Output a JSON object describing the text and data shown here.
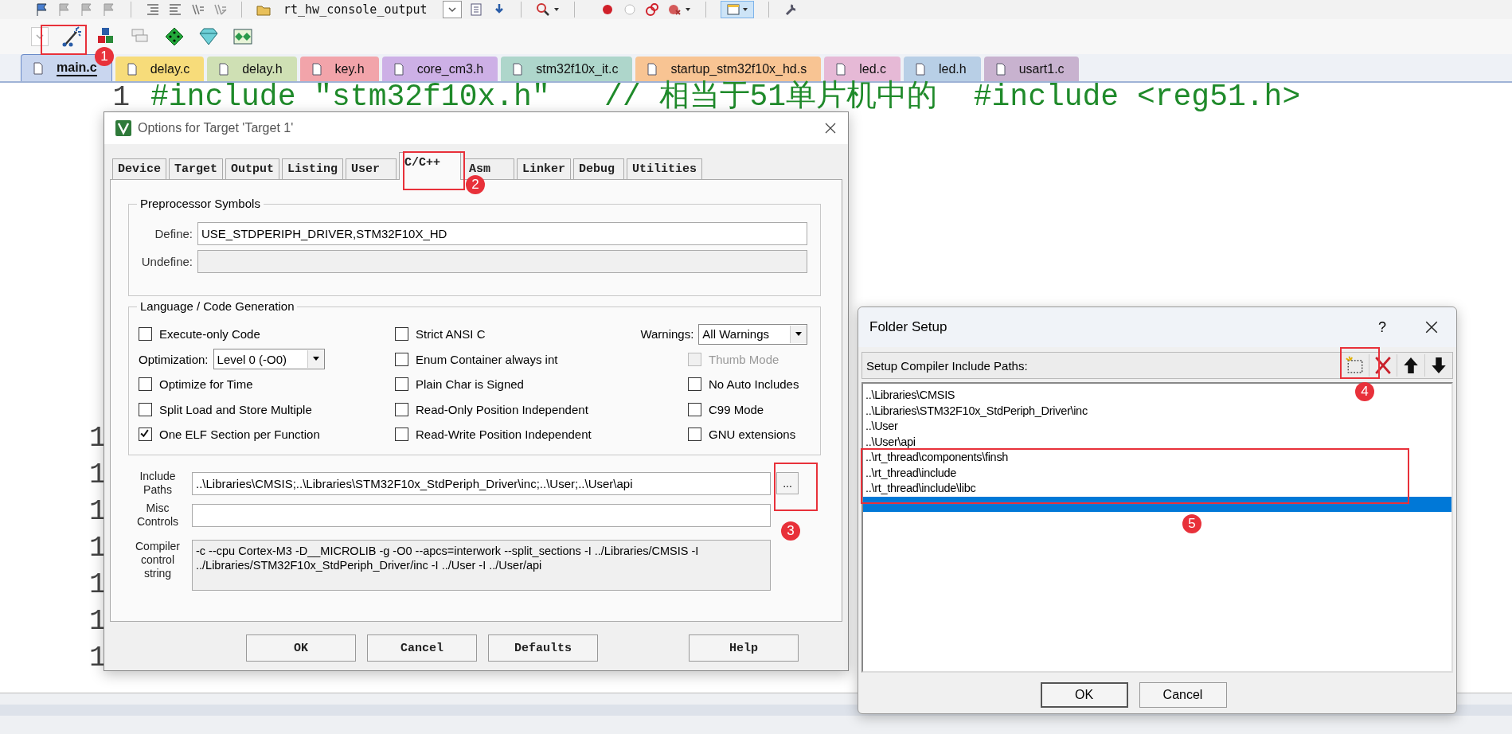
{
  "toolbar": {
    "function_field": "rt_hw_console_output"
  },
  "file_tabs": [
    {
      "label": "main.c",
      "selected": true,
      "color": "#c9d6ef"
    },
    {
      "label": "delay.c",
      "selected": false,
      "color": "#f7dc7a"
    },
    {
      "label": "delay.h",
      "selected": false,
      "color": "#cfe0b4"
    },
    {
      "label": "key.h",
      "selected": false,
      "color": "#f2a4aa"
    },
    {
      "label": "core_cm3.h",
      "selected": false,
      "color": "#cdb0e6"
    },
    {
      "label": "stm32f10x_it.c",
      "selected": false,
      "color": "#aed6cb"
    },
    {
      "label": "startup_stm32f10x_hd.s",
      "selected": false,
      "color": "#f8c493"
    },
    {
      "label": "led.c",
      "selected": false,
      "color": "#e6b9d6"
    },
    {
      "label": "led.h",
      "selected": false,
      "color": "#b8cfe6"
    },
    {
      "label": "usart1.c",
      "selected": false,
      "color": "#c8b2cf"
    }
  ],
  "editor": {
    "line_number": "1",
    "code": "#include \"stm32f10x.h\"   // 相当于51单片机中的  #include <reg51.h>",
    "partial_line_numbers": [
      "1",
      "1",
      "1",
      "1",
      "1",
      "1",
      "1"
    ]
  },
  "options_dialog": {
    "title": "Options for Target 'Target 1'",
    "tabs": [
      {
        "label": "Device",
        "selected": false
      },
      {
        "label": "Target",
        "selected": false
      },
      {
        "label": "Output",
        "selected": false
      },
      {
        "label": "Listing",
        "selected": false
      },
      {
        "label": "User",
        "selected": false
      },
      {
        "label": "C/C++",
        "selected": true
      },
      {
        "label": "Asm",
        "selected": false
      },
      {
        "label": "Linker",
        "selected": false
      },
      {
        "label": "Debug",
        "selected": false
      },
      {
        "label": "Utilities",
        "selected": false
      }
    ],
    "preprocessor": {
      "title": "Preprocessor Symbols",
      "define_label": "Define:",
      "define_value": "USE_STDPERIPH_DRIVER,STM32F10X_HD",
      "undefine_label": "Undefine:"
    },
    "language": {
      "title": "Language / Code Generation",
      "columns": [
        [
          {
            "kind": "checkbox",
            "label": "Execute-only Code",
            "checked": false,
            "disabled": false
          },
          {
            "kind": "select",
            "label": "Optimization:",
            "value": "Level 0 (-O0)"
          },
          {
            "kind": "checkbox",
            "label": "Optimize for Time",
            "checked": false,
            "disabled": false
          },
          {
            "kind": "checkbox",
            "label": "Split Load and Store Multiple",
            "checked": false,
            "disabled": false
          },
          {
            "kind": "checkbox",
            "label": "One ELF Section per Function",
            "checked": true,
            "disabled": false
          }
        ],
        [
          {
            "kind": "checkbox",
            "label": "Strict ANSI C",
            "checked": false,
            "disabled": false
          },
          {
            "kind": "checkbox",
            "label": "Enum Container always int",
            "checked": false,
            "disabled": false
          },
          {
            "kind": "checkbox",
            "label": "Plain Char is Signed",
            "checked": false,
            "disabled": false
          },
          {
            "kind": "checkbox",
            "label": "Read-Only Position Independent",
            "checked": false,
            "disabled": false
          },
          {
            "kind": "checkbox",
            "label": "Read-Write Position Independent",
            "checked": false,
            "disabled": false
          }
        ],
        [
          {
            "kind": "select",
            "label": "Warnings:",
            "value": "All Warnings"
          },
          {
            "kind": "checkbox",
            "label": "Thumb Mode",
            "checked": false,
            "disabled": true
          },
          {
            "kind": "checkbox",
            "label": "No Auto Includes",
            "checked": false,
            "disabled": false
          },
          {
            "kind": "checkbox",
            "label": "C99 Mode",
            "checked": false,
            "disabled": false
          },
          {
            "kind": "checkbox",
            "label": "GNU extensions",
            "checked": false,
            "disabled": false
          }
        ]
      ]
    },
    "include_paths": {
      "label": "Include Paths",
      "value": "..\\Libraries\\CMSIS;..\\Libraries\\STM32F10x_StdPeriph_Driver\\inc;..\\User;..\\User\\api",
      "browse": "..."
    },
    "misc_controls": {
      "label": "Misc Controls"
    },
    "compiler_string": {
      "label": "Compiler control string",
      "value": "-c --cpu Cortex-M3 -D__MICROLIB -g -O0 --apcs=interwork --split_sections -I ../Libraries/CMSIS -I ../Libraries/STM32F10x_StdPeriph_Driver/inc -I ../User -I ../User/api"
    },
    "buttons": [
      "OK",
      "Cancel",
      "Defaults",
      "Help"
    ]
  },
  "folder_dialog": {
    "title": "Folder Setup",
    "help": "?",
    "header_label": "Setup Compiler Include Paths:",
    "paths": [
      {
        "text": "..\\Libraries\\CMSIS",
        "selected": false
      },
      {
        "text": "..\\Libraries\\STM32F10x_StdPeriph_Driver\\inc",
        "selected": false
      },
      {
        "text": "..\\User",
        "selected": false
      },
      {
        "text": "..\\User\\api",
        "selected": false
      },
      {
        "text": "..\\rt_thread\\components\\finsh",
        "selected": false
      },
      {
        "text": "..\\rt_thread\\include",
        "selected": false
      },
      {
        "text": "..\\rt_thread\\include\\libc",
        "selected": false
      },
      {
        "selected": true
      }
    ],
    "buttons": [
      "OK",
      "Cancel"
    ]
  },
  "annotations": [
    {
      "label": "1"
    },
    {
      "label": "2"
    },
    {
      "label": "3"
    },
    {
      "label": "4"
    },
    {
      "label": "5"
    }
  ]
}
